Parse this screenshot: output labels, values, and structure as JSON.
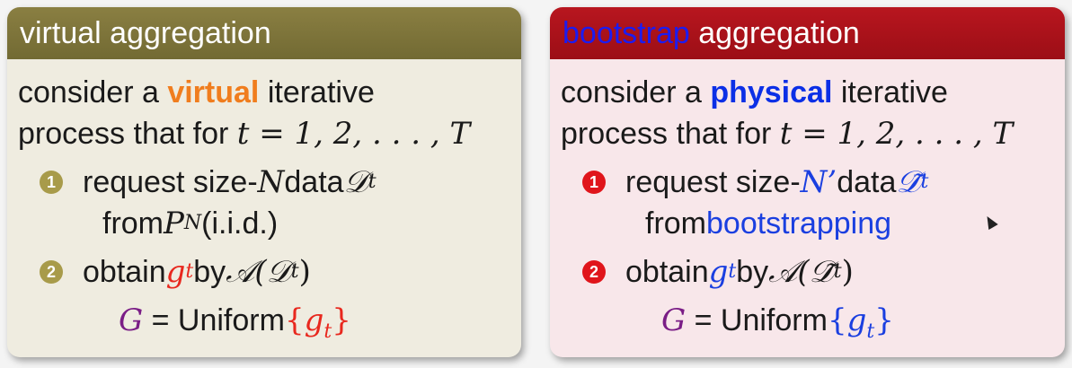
{
  "left": {
    "title": "virtual aggregation",
    "line1_pre": "consider a ",
    "line1_hl": "virtual",
    "line1_post": " iterative",
    "line2_pre": "process that for ",
    "line2_math": "t = 1, 2, . . . , T",
    "item1_num": "1",
    "item1_text": "request size-",
    "item1_N": "N",
    "item1_text2": " data ",
    "item1_D": "𝒟",
    "item1_sub": "t",
    "item1_from": "from ",
    "item1_P": "P",
    "item1_Psup": "N",
    "item1_iid": " (i.i.d.)",
    "item2_num": "2",
    "item2_text": "obtain ",
    "item2_g": "g",
    "item2_gsub": "t",
    "item2_by": " by ",
    "item2_alg": "𝒜(𝒟",
    "item2_algsub": "t",
    "item2_close": ")",
    "G_line_G": "G",
    "G_line_eq": " = Uniform",
    "G_open": "{",
    "G_g": "g",
    "G_gsub": "t",
    "G_close": "}"
  },
  "right": {
    "title_hl": "bootstrap",
    "title_rest": " aggregation",
    "line1_pre": "consider a ",
    "line1_hl": "physical",
    "line1_post": " iterative",
    "line2_pre": "process that for ",
    "line2_math": "t = 1, 2, . . . , T",
    "item1_num": "1",
    "item1_text": "request size-",
    "item1_N": "N’",
    "item1_text2": " data ",
    "item1_D": "𝒟̃",
    "item1_sub": "t",
    "item1_from": "from ",
    "item1_boot": "bootstrapping",
    "item2_num": "2",
    "item2_text": "obtain ",
    "item2_g": "g",
    "item2_gsub": "t",
    "item2_by": " by ",
    "item2_alg": "𝒜(𝒟̃",
    "item2_algsub": "t",
    "item2_close": ")",
    "G_line_G": "G",
    "G_line_eq": " = Uniform",
    "G_open": "{",
    "G_g": "g",
    "G_gsub": "t",
    "G_close": "}"
  }
}
